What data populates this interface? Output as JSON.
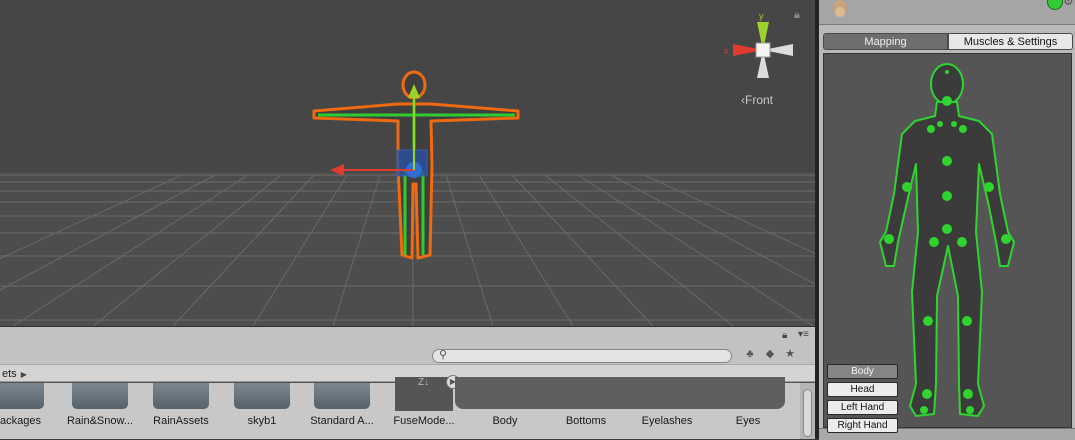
{
  "scene": {
    "view_label": "Front",
    "gizmo_axis_x": "x",
    "gizmo_axis_y": "y",
    "lock_icon": "lock-icon",
    "colors": {
      "selection": "#f06a10",
      "bones": "#2ecc2e",
      "axis_x": "#e03b2c",
      "axis_y": "#9cd32a"
    }
  },
  "project": {
    "search": {
      "placeholder": "",
      "value": ""
    },
    "breadcrumb": "ets",
    "tool_icons": [
      "filter-by-type-icon",
      "filter-by-label-icon",
      "favorite-star-icon"
    ],
    "assets": [
      {
        "label": "ackages",
        "kind": "folder"
      },
      {
        "label": "Rain&Snow...",
        "kind": "folder"
      },
      {
        "label": "RainAssets",
        "kind": "folder"
      },
      {
        "label": "skyb1",
        "kind": "folder"
      },
      {
        "label": "Standard A...",
        "kind": "folder"
      },
      {
        "label": "FuseMode...",
        "kind": "model"
      },
      {
        "label": "Body",
        "kind": "mesh"
      },
      {
        "label": "Bottoms",
        "kind": "mesh"
      },
      {
        "label": "Eyelashes",
        "kind": "mesh"
      },
      {
        "label": "Eyes",
        "kind": "mesh"
      }
    ]
  },
  "inspector": {
    "tabs": [
      {
        "label": "Mapping",
        "active": true
      },
      {
        "label": "Muscles & Settings",
        "active": false
      }
    ],
    "body_parts": [
      {
        "label": "Body",
        "active": true
      },
      {
        "label": "Head",
        "active": false
      },
      {
        "label": "Left Hand",
        "active": false
      },
      {
        "label": "Right Hand",
        "active": false
      }
    ],
    "colors": {
      "avatar_fill": "#3b3b3b",
      "avatar_outline": "#2fd42f"
    }
  }
}
